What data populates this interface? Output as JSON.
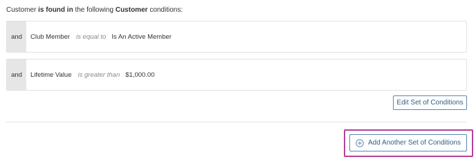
{
  "intro": {
    "part1": "Customer",
    "part2": "is found in",
    "part3": "the following",
    "part4": "Customer",
    "part5": "conditions:"
  },
  "conditions": [
    {
      "operator": "and",
      "field": "Club Member",
      "comparison": "is equal to",
      "value": "Is An Active Member"
    },
    {
      "operator": "and",
      "field": "Lifetime Value",
      "comparison": "is greater than",
      "value": "$1,000.00"
    }
  ],
  "buttons": {
    "edit_label": "Edit Set of Conditions",
    "add_label": "Add Another Set of Conditions",
    "add_icon": "plus-circle-icon"
  },
  "colors": {
    "button_border": "#5b88b0",
    "button_text": "#2f5f86",
    "highlight": "#b5409a",
    "operator_bg": "#e6e6e6"
  }
}
